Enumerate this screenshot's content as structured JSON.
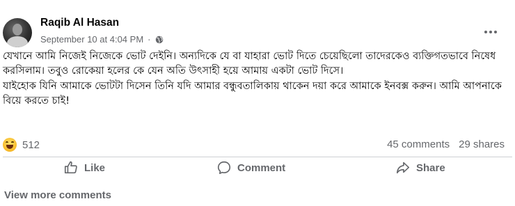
{
  "post": {
    "author": "Raqib Al Hasan",
    "timestamp": "September 10 at 4:04 PM",
    "separator": "·",
    "privacy_icon": "globe-icon",
    "more_icon": "more-options-icon",
    "paragraphs": [
      "যেখানে আমি নিজেই নিজেকে ভোট দেইনি। অন্যদিকে যে বা যাহারা ভোট দিতে চেয়েছিলো তাদেরকেও ব্যক্তিগতভাবে নিষেধ করসিলাম। তবুও রোকেয়া হলের কে যেন অতি উৎসাহী হয়ে আমায় একটা ভোট দিসে।",
      "যাইহোক যিনি আমাকে ভোটটা দিসেন তিনি যদি আমার বন্ধুবতালিকায় থাকেন দয়া করে আমাকে ইনবক্স করুন। আমি আপনাকে বিয়ে করতে চাই!"
    ]
  },
  "reactions": {
    "icon": "haha-icon",
    "count": "512",
    "comments": "45 comments",
    "shares": "29 shares"
  },
  "actions": {
    "like": "Like",
    "comment": "Comment",
    "share": "Share"
  },
  "footer": {
    "view_more": "View more comments"
  }
}
